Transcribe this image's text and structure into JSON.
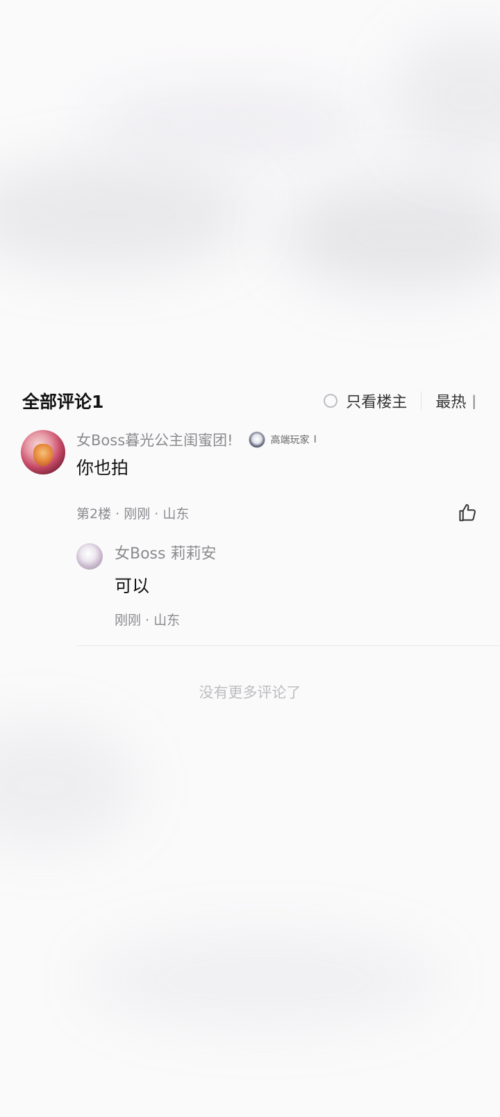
{
  "comments_header": {
    "title": "全部评论1",
    "only_op_label": "只看楼主",
    "sort_label": "最热",
    "sort_icon": "sort-lines-icon"
  },
  "comment": {
    "username": "女Boss暮光公主闺蜜团!",
    "badge_icon": "player-badge-icon",
    "badge_text": "高端玩家",
    "badge_suffix": "I",
    "text": "你也拍",
    "meta": "第2楼 · 刚刚 · 山东",
    "like_icon": "thumbs-up-icon"
  },
  "reply": {
    "username": "女Boss 莉莉安",
    "text": "可以",
    "meta": "刚刚 · 山东"
  },
  "footer": {
    "no_more_text": "没有更多评论了"
  }
}
